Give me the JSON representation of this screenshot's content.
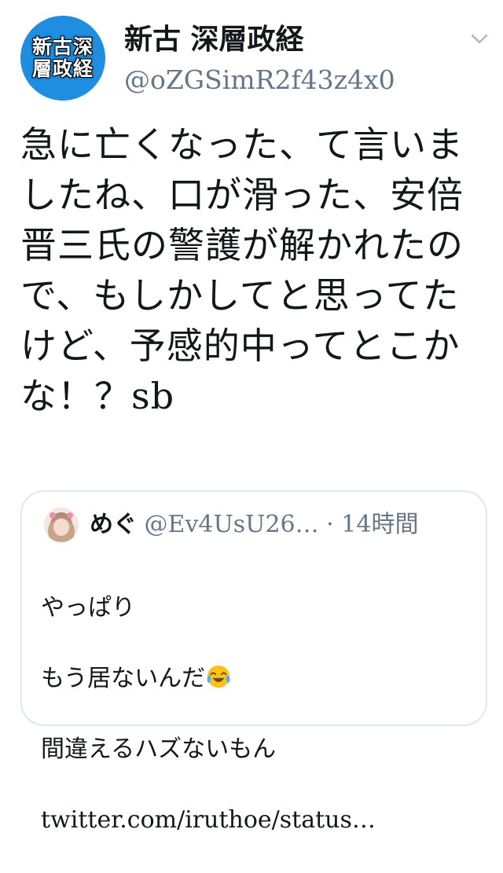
{
  "tweet": {
    "avatar_text": "新古深層政経",
    "display_name": "新古 深層政経",
    "handle": "@oZGSimR2f43z4x0",
    "text": "急に亡くなった、て言いましたね、口が滑った、安倍晋三氏の警護が解かれたので、もしかしてと思ってたけど、予感的中ってとこかな！？sb",
    "menu_icon": "chevron-down-icon"
  },
  "quoted": {
    "display_name": "めぐ",
    "handle": "@Ev4UsU26…",
    "separator": "·",
    "time": "14時間",
    "lines": [
      "やっぱり",
      "もう居ないんだ",
      "間違えるハズないもん",
      "twitter.com/iruthoe/status…"
    ],
    "emoji": "face-with-tears-of-joy"
  },
  "colors": {
    "avatar_bg": "#1f8de0",
    "secondary_text": "#657786",
    "border": "#e1e8ed"
  }
}
